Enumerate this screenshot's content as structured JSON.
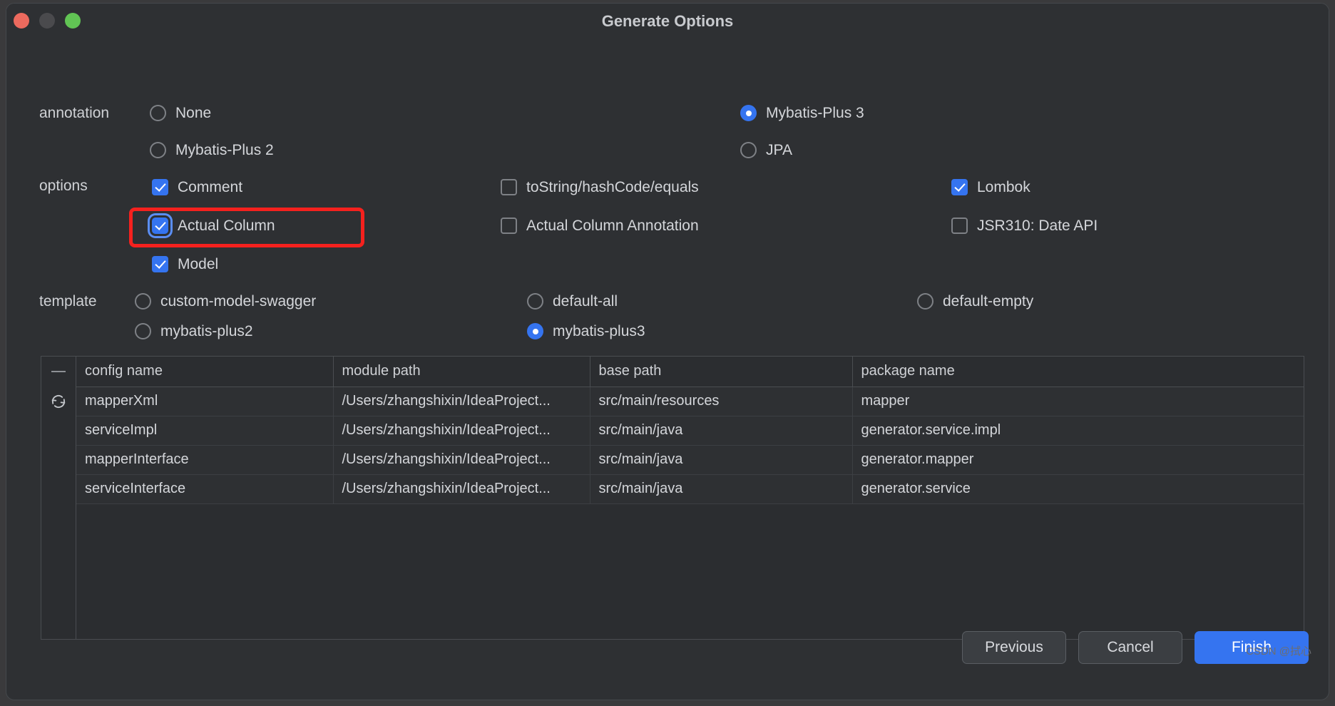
{
  "window": {
    "title": "Generate Options",
    "traffic_lights": [
      "close-button",
      "minimize-button",
      "zoom-button"
    ]
  },
  "colors": {
    "accent": "#3574f0",
    "annotation": "#f5211e",
    "window_bg": "#2e3033",
    "table_bg": "#2b2d30",
    "text": "#d4d6da"
  },
  "sections": {
    "annotation": {
      "label": "annotation",
      "options": [
        {
          "label": "None",
          "selected": false
        },
        {
          "label": "Mybatis-Plus 3",
          "selected": true
        },
        {
          "label": "Mybatis-Plus 2",
          "selected": false
        },
        {
          "label": "JPA",
          "selected": false
        }
      ]
    },
    "options": {
      "label": "options",
      "items": [
        {
          "label": "Comment",
          "checked": true,
          "focused": false
        },
        {
          "label": "toString/hashCode/equals",
          "checked": false,
          "focused": false
        },
        {
          "label": "Lombok",
          "checked": true,
          "focused": false
        },
        {
          "label": "Actual Column",
          "checked": true,
          "focused": true
        },
        {
          "label": "Actual Column Annotation",
          "checked": false,
          "focused": false
        },
        {
          "label": "JSR310: Date API",
          "checked": false,
          "focused": false
        },
        {
          "label": "Model",
          "checked": true,
          "focused": false
        }
      ]
    },
    "template": {
      "label": "template",
      "options": [
        {
          "label": "custom-model-swagger",
          "selected": false
        },
        {
          "label": "default-all",
          "selected": false
        },
        {
          "label": "default-empty",
          "selected": false
        },
        {
          "label": "mybatis-plus2",
          "selected": false
        },
        {
          "label": "mybatis-plus3",
          "selected": true
        }
      ]
    }
  },
  "table": {
    "gutter_icons": [
      "minus-icon",
      "refresh-icon"
    ],
    "columns": [
      "config name",
      "module path",
      "base path",
      "package name"
    ],
    "rows": [
      [
        "mapperXml",
        "/Users/zhangshixin/IdeaProject...",
        "src/main/resources",
        "mapper"
      ],
      [
        "serviceImpl",
        "/Users/zhangshixin/IdeaProject...",
        "src/main/java",
        "generator.service.impl"
      ],
      [
        "mapperInterface",
        "/Users/zhangshixin/IdeaProject...",
        "src/main/java",
        "generator.mapper"
      ],
      [
        "serviceInterface",
        "/Users/zhangshixin/IdeaProject...",
        "src/main/java",
        "generator.service"
      ]
    ]
  },
  "footer": {
    "previous_label": "Previous",
    "cancel_label": "Cancel",
    "finish_label": "Finish",
    "watermark": "CSDN @拭心"
  }
}
